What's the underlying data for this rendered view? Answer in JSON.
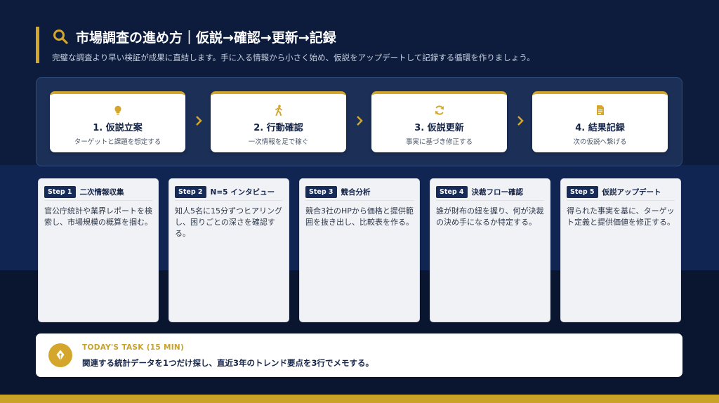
{
  "header": {
    "title": "市場調査の進め方｜仮説→確認→更新→記録",
    "subtitle": "完璧な調査より早い検証が成果に直結します。手に入る情報から小さく始め、仮説をアップデートして記録する循環を作りましょう。",
    "icon": "search-icon"
  },
  "colors": {
    "accent": "#d4a72c",
    "navy": "#0d1c3d",
    "badge": "#162b57"
  },
  "process": [
    {
      "title": "1. 仮説立案",
      "desc": "ターゲットと課題を想定する",
      "icon": "lightbulb-icon"
    },
    {
      "title": "2. 行動確認",
      "desc": "一次情報を足で稼ぐ",
      "icon": "walking-person-icon"
    },
    {
      "title": "3. 仮説更新",
      "desc": "事実に基づき修正する",
      "icon": "refresh-icon"
    },
    {
      "title": "4. 結果記録",
      "desc": "次の仮説へ繋げる",
      "icon": "document-icon"
    }
  ],
  "steps": [
    {
      "badge": "Step 1",
      "title": "二次情報収集",
      "body": "官公庁統計や業界レポートを検索し、市場規模の概算を掴む。"
    },
    {
      "badge": "Step 2",
      "title": "N=5 インタビュー",
      "body": "知人5名に15分ずつヒアリングし、困りごとの深さを確認する。"
    },
    {
      "badge": "Step 3",
      "title": "競合分析",
      "body": "競合3社のHPから価格と提供範囲を抜き出し、比較表を作る。"
    },
    {
      "badge": "Step 4",
      "title": "決裁フロー確認",
      "body": "誰が財布の紐を握り、何が決裁の決め手になるか特定する。"
    },
    {
      "badge": "Step 5",
      "title": "仮説アップデート",
      "body": "得られた事実を基に、ターゲット定義と提供価値を修正する。"
    }
  ],
  "task": {
    "label": "TODAY'S TASK (15 MIN)",
    "text": "関連する統計データを1つだけ探し、直近3年のトレンド要点を3行でメモする。",
    "icon": "pen-nib-icon"
  }
}
